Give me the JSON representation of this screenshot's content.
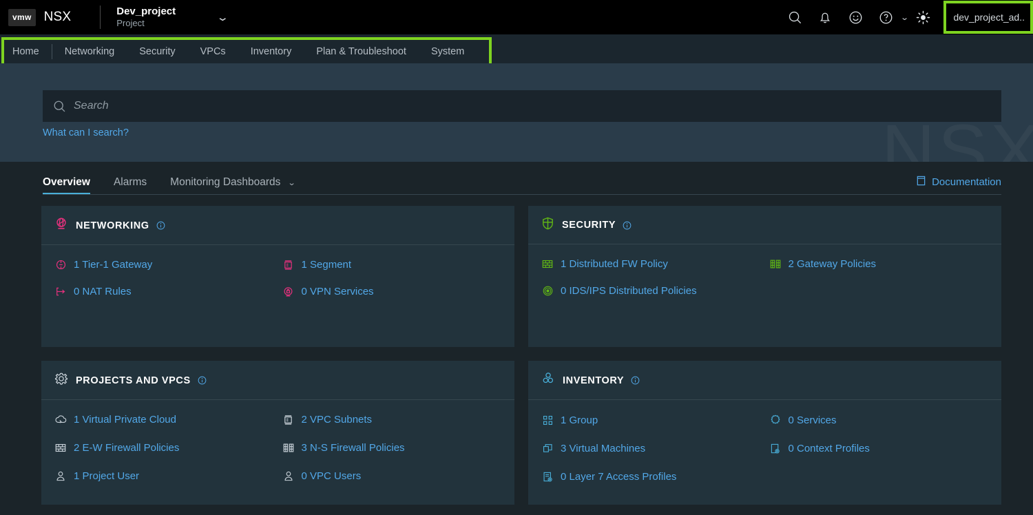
{
  "header": {
    "logo_text": "vmw",
    "product_name": "NSX",
    "project_name": "Dev_project",
    "project_label": "Project",
    "project_chevron": "chevron-down",
    "icons": [
      "search-icon",
      "bell-icon",
      "smiley-icon",
      "help-icon",
      "theme-sun-icon"
    ],
    "help_chevron": "chevron-down",
    "user_name": "dev_project_ad..",
    "highlight_color": "#7ed321"
  },
  "nav": {
    "items": [
      {
        "label": "Home"
      },
      {
        "label": "Networking"
      },
      {
        "label": "Security"
      },
      {
        "label": "VPCs"
      },
      {
        "label": "Inventory"
      },
      {
        "label": "Plan & Troubleshoot"
      },
      {
        "label": "System"
      }
    ],
    "highlight_color": "#7ed321"
  },
  "banner": {
    "watermark": "NSX",
    "search": {
      "placeholder": "Search",
      "value": "",
      "icon": "search-icon"
    },
    "help_link": "What can I search?"
  },
  "tabs": {
    "items": [
      {
        "label": "Overview",
        "active": true
      },
      {
        "label": "Alarms",
        "active": false
      },
      {
        "label": "Monitoring Dashboards",
        "active": false,
        "chevron": "chevron-down"
      }
    ],
    "documentation": {
      "label": "Documentation",
      "icon": "document-icon"
    }
  },
  "cards": {
    "networking": {
      "title": "NETWORKING",
      "icon": "network-globe-icon",
      "accent": "#e6317d",
      "info_icon": "info-icon",
      "stats": [
        {
          "label": "1 Tier-1 Gateway",
          "icon": "tier1-gateway-icon"
        },
        {
          "label": "1 Segment",
          "icon": "segment-icon"
        },
        {
          "label": "0 NAT Rules",
          "icon": "nat-rules-icon"
        },
        {
          "label": "0 VPN Services",
          "icon": "vpn-lock-icon"
        }
      ]
    },
    "security": {
      "title": "SECURITY",
      "icon": "shield-icon",
      "accent": "#60b515",
      "info_icon": "info-icon",
      "stats": [
        {
          "label": "1 Distributed FW Policy",
          "icon": "firewall-icon"
        },
        {
          "label": "2 Gateway Policies",
          "icon": "gateway-policy-icon"
        },
        {
          "label": "0 IDS/IPS Distributed Policies",
          "icon": "ids-ips-icon"
        }
      ]
    },
    "projects_vpcs": {
      "title": "PROJECTS AND VPCS",
      "icon": "gear-icon",
      "accent": "#c8d1d8",
      "info_icon": "info-icon",
      "stats": [
        {
          "label": "1 Virtual Private Cloud",
          "icon": "cloud-icon"
        },
        {
          "label": "2 VPC Subnets",
          "icon": "subnet-icon"
        },
        {
          "label": "2 E-W Firewall Policies",
          "icon": "firewall-icon"
        },
        {
          "label": "3 N-S Firewall Policies",
          "icon": "gateway-policy-icon"
        },
        {
          "label": "1 Project User",
          "icon": "user-icon"
        },
        {
          "label": "0 VPC Users",
          "icon": "user-icon"
        }
      ]
    },
    "inventory": {
      "title": "INVENTORY",
      "icon": "inventory-blocks-icon",
      "accent": "#49afd9",
      "info_icon": "info-icon",
      "stats": [
        {
          "label": "1 Group",
          "icon": "group-icon"
        },
        {
          "label": "0 Services",
          "icon": "services-gear-icon"
        },
        {
          "label": "3 Virtual Machines",
          "icon": "vm-icon"
        },
        {
          "label": "0 Context Profiles",
          "icon": "context-profile-icon"
        },
        {
          "label": "0 Layer 7 Access Profiles",
          "icon": "layer7-profile-icon"
        }
      ]
    }
  }
}
